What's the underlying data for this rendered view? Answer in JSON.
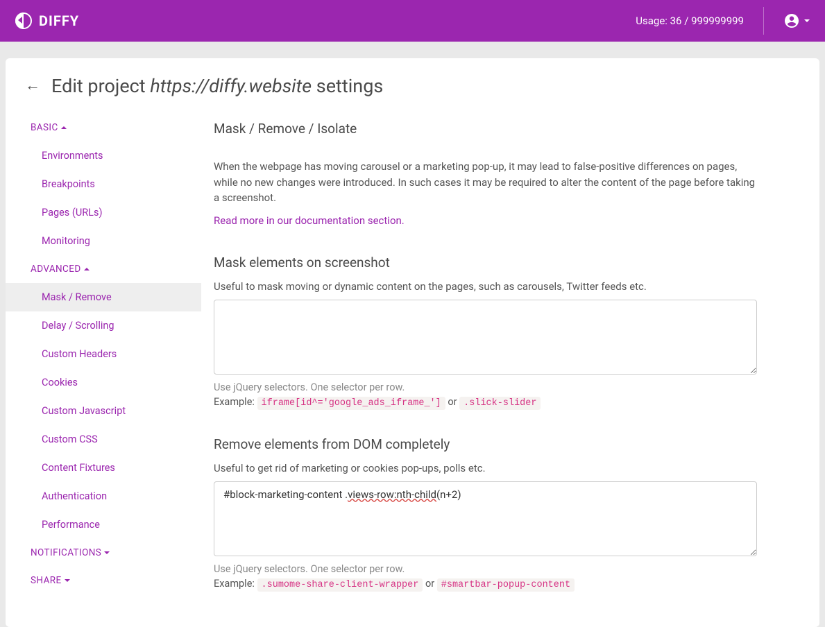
{
  "header": {
    "brand": "DIFFY",
    "usage": "Usage: 36 / 999999999"
  },
  "page": {
    "title_prefix": "Edit project ",
    "project_url": "https://diffy.website",
    "title_suffix": " settings"
  },
  "sidebar": {
    "basic": {
      "label": "BASIC",
      "items": [
        "Environments",
        "Breakpoints",
        "Pages (URLs)",
        "Monitoring"
      ]
    },
    "advanced": {
      "label": "ADVANCED",
      "items": [
        "Mask / Remove",
        "Delay / Scrolling",
        "Custom Headers",
        "Cookies",
        "Custom Javascript",
        "Custom CSS",
        "Content Fixtures",
        "Authentication",
        "Performance"
      ]
    },
    "notifications": {
      "label": "NOTIFICATIONS"
    },
    "share": {
      "label": "SHARE"
    }
  },
  "main": {
    "heading": "Mask / Remove / Isolate",
    "intro": "When the webpage has moving carousel or a marketing pop-up, it may lead to false-positive differences on pages, while no new changes were introduced. In such cases it may be required to alter the content of the page before taking a screenshot.",
    "doc_link": "Read more in our documentation section.",
    "mask": {
      "title": "Mask elements on screenshot",
      "desc": "Useful to mask moving or dynamic content on the pages, such as carousels, Twitter feeds etc.",
      "value": "",
      "hint": "Use jQuery selectors. One selector per row.",
      "example_label": "Example: ",
      "example1": "iframe[id^='google_ads_iframe_']",
      "or": " or ",
      "example2": ".slick-slider"
    },
    "remove": {
      "title": "Remove elements from DOM completely",
      "desc": "Useful to get rid of marketing or cookies pop-ups, polls etc.",
      "value_prefix": "#block-marketing-content .",
      "value_mid": "views-row:nth-child",
      "value_suffix": "(n+2)",
      "hint": "Use jQuery selectors. One selector per row.",
      "example_label": "Example: ",
      "example1": ".sumome-share-client-wrapper",
      "or": " or ",
      "example2": "#smartbar-popup-content"
    }
  }
}
